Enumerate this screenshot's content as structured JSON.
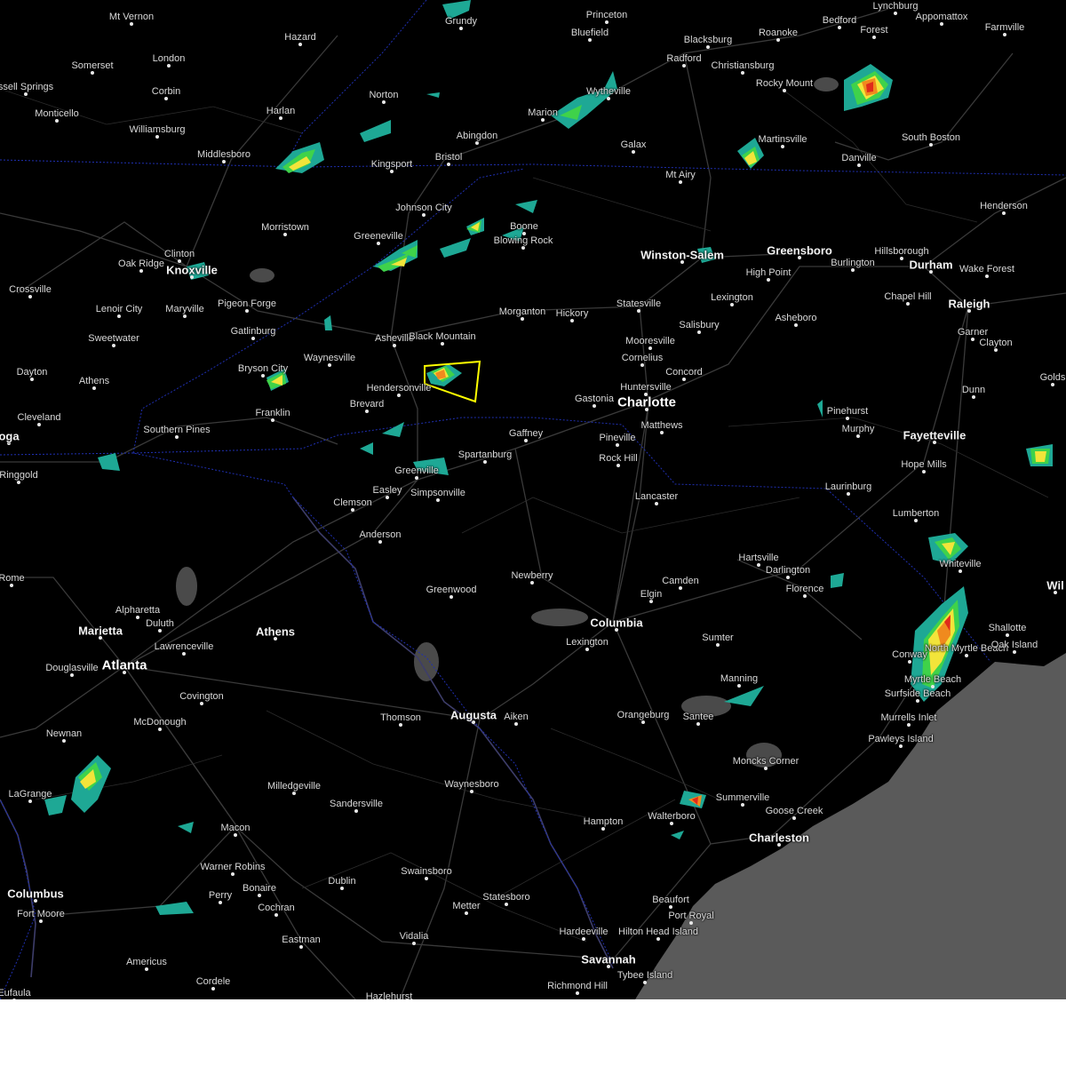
{
  "cities": [
    {
      "name": "Mt Vernon",
      "size": "small"
    },
    {
      "name": "Hazard",
      "size": "small"
    },
    {
      "name": "Grundy",
      "size": "small"
    },
    {
      "name": "Princeton",
      "size": "small"
    },
    {
      "name": "Bluefield",
      "size": "small"
    },
    {
      "name": "Lynchburg",
      "size": "small"
    },
    {
      "name": "Bedford",
      "size": "small"
    },
    {
      "name": "Forest",
      "size": "small"
    },
    {
      "name": "Appomattox",
      "size": "small"
    },
    {
      "name": "Farmville",
      "size": "small"
    },
    {
      "name": "Blacksburg",
      "size": "small"
    },
    {
      "name": "Roanoke",
      "size": "small"
    },
    {
      "name": "Radford",
      "size": "small"
    },
    {
      "name": "Christiansburg",
      "size": "small"
    },
    {
      "name": "Somerset",
      "size": "small"
    },
    {
      "name": "London",
      "size": "small"
    },
    {
      "name": "ssell Springs",
      "size": "small"
    },
    {
      "name": "Corbin",
      "size": "small"
    },
    {
      "name": "Monticello",
      "size": "small"
    },
    {
      "name": "Norton",
      "size": "small"
    },
    {
      "name": "Harlan",
      "size": "small"
    },
    {
      "name": "Wytheville",
      "size": "small"
    },
    {
      "name": "Rocky Mount",
      "size": "small"
    },
    {
      "name": "Marion",
      "size": "small"
    },
    {
      "name": "Williamsburg",
      "size": "small"
    },
    {
      "name": "Abingdon",
      "size": "small"
    },
    {
      "name": "South Boston",
      "size": "small"
    },
    {
      "name": "Galax",
      "size": "small"
    },
    {
      "name": "Martinsville",
      "size": "small"
    },
    {
      "name": "Middlesboro",
      "size": "small"
    },
    {
      "name": "Bristol",
      "size": "small"
    },
    {
      "name": "Kingsport",
      "size": "small"
    },
    {
      "name": "Danville",
      "size": "small"
    },
    {
      "name": "Mt Airy",
      "size": "small"
    },
    {
      "name": "Henderson",
      "size": "small"
    },
    {
      "name": "Johnson City",
      "size": "small"
    },
    {
      "name": "Morristown",
      "size": "small"
    },
    {
      "name": "Boone",
      "size": "small"
    },
    {
      "name": "Greeneville",
      "size": "small"
    },
    {
      "name": "Blowing Rock",
      "size": "small"
    },
    {
      "name": "Clinton",
      "size": "small"
    },
    {
      "name": "Oak Ridge",
      "size": "small"
    },
    {
      "name": "Knoxville",
      "size": "big"
    },
    {
      "name": "Winston-Salem",
      "size": "big"
    },
    {
      "name": "Greensboro",
      "size": "big"
    },
    {
      "name": "Hillsborough",
      "size": "small"
    },
    {
      "name": "Burlington",
      "size": "small"
    },
    {
      "name": "Durham",
      "size": "big"
    },
    {
      "name": "Wake Forest",
      "size": "small"
    },
    {
      "name": "High Point",
      "size": "small"
    },
    {
      "name": "Crossville",
      "size": "small"
    },
    {
      "name": "Lenoir City",
      "size": "small"
    },
    {
      "name": "Maryville",
      "size": "small"
    },
    {
      "name": "Pigeon Forge",
      "size": "small"
    },
    {
      "name": "Chapel Hill",
      "size": "small"
    },
    {
      "name": "Raleigh",
      "size": "big"
    },
    {
      "name": "Lexington",
      "size": "small"
    },
    {
      "name": "Morganton",
      "size": "small"
    },
    {
      "name": "Hickory",
      "size": "small"
    },
    {
      "name": "Statesville",
      "size": "small"
    },
    {
      "name": "Sweetwater",
      "size": "small"
    },
    {
      "name": "Gatlinburg",
      "size": "small"
    },
    {
      "name": "Asheville",
      "size": "small"
    },
    {
      "name": "Black Mountain",
      "size": "small"
    },
    {
      "name": "Asheboro",
      "size": "small"
    },
    {
      "name": "Salisbury",
      "size": "small"
    },
    {
      "name": "Garner",
      "size": "small"
    },
    {
      "name": "Clayton",
      "size": "small"
    },
    {
      "name": "Mooresville",
      "size": "small"
    },
    {
      "name": "Cornelius",
      "size": "small"
    },
    {
      "name": "Waynesville",
      "size": "small"
    },
    {
      "name": "Dayton",
      "size": "small"
    },
    {
      "name": "Bryson City",
      "size": "small"
    },
    {
      "name": "Concord",
      "size": "small"
    },
    {
      "name": "Athens",
      "size": "small"
    },
    {
      "name": "Hendersonville",
      "size": "small"
    },
    {
      "name": "Huntersville",
      "size": "small"
    },
    {
      "name": "Dunn",
      "size": "small"
    },
    {
      "name": "Gastonia",
      "size": "small"
    },
    {
      "name": "Charlotte",
      "size": "huge"
    },
    {
      "name": "Brevard",
      "size": "small"
    },
    {
      "name": "Pinehurst",
      "size": "small"
    },
    {
      "name": "Cleveland",
      "size": "small"
    },
    {
      "name": "Franklin",
      "size": "small"
    },
    {
      "name": "Matthews",
      "size": "small"
    },
    {
      "name": "Southern Pines",
      "size": "small"
    },
    {
      "name": "Murphy",
      "size": "small"
    },
    {
      "name": "Gaffney",
      "size": "small"
    },
    {
      "name": "Pineville",
      "size": "small"
    },
    {
      "name": "Fayetteville",
      "size": "big"
    },
    {
      "name": "oga",
      "size": "big"
    },
    {
      "name": "Spartanburg",
      "size": "small"
    },
    {
      "name": "Rock Hill",
      "size": "small"
    },
    {
      "name": "Hope Mills",
      "size": "small"
    },
    {
      "name": "Greenville",
      "size": "small"
    },
    {
      "name": "Ringgold",
      "size": "small"
    },
    {
      "name": "Easley",
      "size": "small"
    },
    {
      "name": "Simpsonville",
      "size": "small"
    },
    {
      "name": "Laurinburg",
      "size": "small"
    },
    {
      "name": "Lancaster",
      "size": "small"
    },
    {
      "name": "Clemson",
      "size": "small"
    },
    {
      "name": "Lumberton",
      "size": "small"
    },
    {
      "name": "Anderson",
      "size": "small"
    },
    {
      "name": "Hartsville",
      "size": "small"
    },
    {
      "name": "Whiteville",
      "size": "small"
    },
    {
      "name": "Darlington",
      "size": "small"
    },
    {
      "name": "Newberry",
      "size": "small"
    },
    {
      "name": "Rome",
      "size": "small"
    },
    {
      "name": "Camden",
      "size": "small"
    },
    {
      "name": "Greenwood",
      "size": "small"
    },
    {
      "name": "Florence",
      "size": "small"
    },
    {
      "name": "Elgin",
      "size": "small"
    },
    {
      "name": "Alpharetta",
      "size": "small"
    },
    {
      "name": "Columbia",
      "size": "big"
    },
    {
      "name": "Wil",
      "size": "big"
    },
    {
      "name": "Shallotte",
      "size": "small"
    },
    {
      "name": "Duluth",
      "size": "small"
    },
    {
      "name": "Marietta",
      "size": "big"
    },
    {
      "name": "Athens",
      "size": "big"
    },
    {
      "name": "Lexington",
      "size": "small"
    },
    {
      "name": "Lawrenceville",
      "size": "small"
    },
    {
      "name": "Sumter",
      "size": "small"
    },
    {
      "name": "North Myrtle Beach",
      "size": "small"
    },
    {
      "name": "Oak Island",
      "size": "small"
    },
    {
      "name": "Conway",
      "size": "small"
    },
    {
      "name": "Atlanta",
      "size": "huge"
    },
    {
      "name": "Douglasville",
      "size": "small"
    },
    {
      "name": "Manning",
      "size": "small"
    },
    {
      "name": "Myrtle Beach",
      "size": "small"
    },
    {
      "name": "Surfside Beach",
      "size": "small"
    },
    {
      "name": "Covington",
      "size": "small"
    },
    {
      "name": "Augusta",
      "size": "big"
    },
    {
      "name": "Aiken",
      "size": "small"
    },
    {
      "name": "Orangeburg",
      "size": "small"
    },
    {
      "name": "Thomson",
      "size": "small"
    },
    {
      "name": "Santee",
      "size": "small"
    },
    {
      "name": "Murrells Inlet",
      "size": "small"
    },
    {
      "name": "McDonough",
      "size": "small"
    },
    {
      "name": "Newnan",
      "size": "small"
    },
    {
      "name": "Pawleys Island",
      "size": "small"
    },
    {
      "name": "Moncks Corner",
      "size": "small"
    },
    {
      "name": "Waynesboro",
      "size": "small"
    },
    {
      "name": "Milledgeville",
      "size": "small"
    },
    {
      "name": "Summerville",
      "size": "small"
    },
    {
      "name": "LaGrange",
      "size": "small"
    },
    {
      "name": "Goose Creek",
      "size": "small"
    },
    {
      "name": "Sandersville",
      "size": "small"
    },
    {
      "name": "Walterboro",
      "size": "small"
    },
    {
      "name": "Hampton",
      "size": "small"
    },
    {
      "name": "Macon",
      "size": "small"
    },
    {
      "name": "Charleston",
      "size": "big"
    },
    {
      "name": "Warner Robins",
      "size": "small"
    },
    {
      "name": "Swainsboro",
      "size": "small"
    },
    {
      "name": "Dublin",
      "size": "small"
    },
    {
      "name": "Bonaire",
      "size": "small"
    },
    {
      "name": "Columbus",
      "size": "big"
    },
    {
      "name": "Statesboro",
      "size": "small"
    },
    {
      "name": "Perry",
      "size": "small"
    },
    {
      "name": "Beaufort",
      "size": "small"
    },
    {
      "name": "Port Royal",
      "size": "small"
    },
    {
      "name": "Metter",
      "size": "small"
    },
    {
      "name": "Cochran",
      "size": "small"
    },
    {
      "name": "Fort Moore",
      "size": "small"
    },
    {
      "name": "Hilton Head Island",
      "size": "small"
    },
    {
      "name": "Hardeeville",
      "size": "small"
    },
    {
      "name": "Eastman",
      "size": "small"
    },
    {
      "name": "Vidalia",
      "size": "small"
    },
    {
      "name": "Savannah",
      "size": "big"
    },
    {
      "name": "Americus",
      "size": "small"
    },
    {
      "name": "Tybee Island",
      "size": "small"
    },
    {
      "name": "Cordele",
      "size": "small"
    },
    {
      "name": "Richmond Hill",
      "size": "small"
    },
    {
      "name": "Eufaula",
      "size": "small"
    },
    {
      "name": "Hazlehurst",
      "size": "small"
    },
    {
      "name": "Golds",
      "size": "small"
    }
  ],
  "colors": {
    "background": "#000000",
    "ocean": "#5a5a5a",
    "roads": "#3a3a3a",
    "state_lines": "#1f2fb0",
    "rivers": "#3d3d6a",
    "lakes": "#4a4a4a",
    "warning_polygon": "#ffff00",
    "radar_light": "#1ea895",
    "radar_green": "#3fd24a",
    "radar_yellow": "#f2e43a",
    "radar_orange": "#f08a1e",
    "radar_red": "#e02a1a"
  },
  "warning_polygon": {
    "type": "severe-thunderstorm-warning",
    "color": "#ffff00"
  }
}
